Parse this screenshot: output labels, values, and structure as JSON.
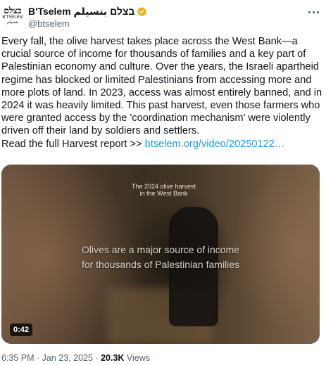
{
  "account": {
    "avatar_lines": [
      "בצלם",
      "B'TSELEM",
      "بتسيلم"
    ],
    "display_name": "B'Tselem בצלם بتسيلم",
    "handle": "@btselem",
    "verified_icon": "verified-badge-gold",
    "verified_color": "#e8b21b"
  },
  "tweet": {
    "text": "Every fall, the olive harvest takes place across the West Bank—a crucial source of income for thousands of families and a key part of Palestinian economy and culture. Over the years, the Israeli apartheid regime has blocked or limited Palestinians from accessing more and more plots of land. In 2023, access was almost entirely banned, and in 2024 it was heavily limited. This past harvest, even those farmers who were granted access by the 'coordination mechanism' were violently driven off their land by soldiers and settlers.",
    "read_more_prefix": "Read the full Harvest report >> ",
    "link_text": "btselem.org/video/20250122…",
    "link_color": "#1d9bf0"
  },
  "media": {
    "video_title_line1": "The 2024 olive harvest",
    "video_title_line2": "in the West Bank",
    "caption_line1": "Olives are a major source of income",
    "caption_line2": "for thousands of Palestinian families",
    "duration": "0:42"
  },
  "meta": {
    "time": "6:35 PM",
    "separator": " · ",
    "date": "Jan 23, 2025",
    "views_count": "20.3K",
    "views_label": "Views"
  },
  "menu": {
    "more_icon": "more-horizontal-icon"
  }
}
